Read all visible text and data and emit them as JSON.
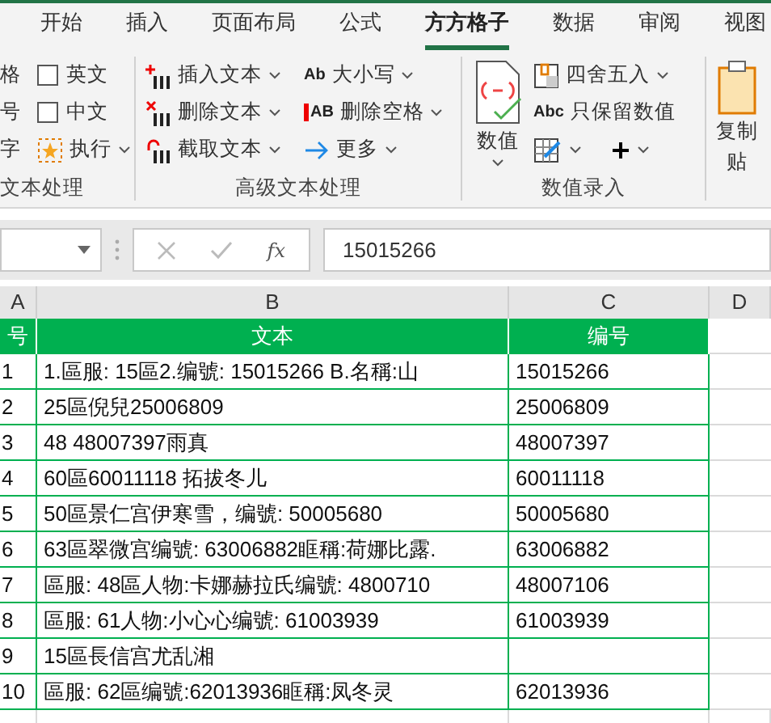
{
  "tabs": [
    {
      "label": "开始",
      "selected": false
    },
    {
      "label": "插入",
      "selected": false
    },
    {
      "label": "页面布局",
      "selected": false
    },
    {
      "label": "公式",
      "selected": false
    },
    {
      "label": "方方格子",
      "selected": true
    },
    {
      "label": "数据",
      "selected": false
    },
    {
      "label": "审阅",
      "selected": false
    },
    {
      "label": "视图",
      "selected": false
    }
  ],
  "ribbon": {
    "groups": [
      {
        "label": "文本处理",
        "columns": [
          [
            {
              "kind": "text",
              "label": "格"
            },
            {
              "kind": "text",
              "label": "号"
            },
            {
              "kind": "text",
              "label": "字"
            }
          ],
          [
            {
              "kind": "checkbox",
              "label": "英文",
              "checked": false
            },
            {
              "kind": "checkbox",
              "label": "中文",
              "checked": false
            },
            {
              "kind": "menu",
              "label": "执行",
              "dropdown": true
            }
          ]
        ]
      },
      {
        "label": "高级文本处理",
        "columns": [
          [
            {
              "kind": "menu",
              "label": "插入文本",
              "dropdown": true
            },
            {
              "kind": "menu",
              "label": "删除文本",
              "dropdown": true
            },
            {
              "kind": "menu",
              "label": "截取文本",
              "dropdown": true
            }
          ],
          [
            {
              "kind": "menu",
              "badge": "Ab",
              "label": "大小写",
              "dropdown": true
            },
            {
              "kind": "menu",
              "badge": "AB",
              "label": "删除空格",
              "dropdown": true
            },
            {
              "kind": "menu",
              "label": "更多",
              "dropdown": true
            }
          ]
        ]
      },
      {
        "label": "数值录入",
        "columns": [
          [
            {
              "kind": "big",
              "label": "数值",
              "dropdown": true
            }
          ],
          [
            {
              "kind": "menu",
              "label": "四舍五入",
              "dropdown": true
            },
            {
              "kind": "menu",
              "badge": "Abc",
              "label": "只保留数值"
            },
            {
              "kind": "icons",
              "dropdown": true
            }
          ]
        ]
      },
      {
        "columns": [
          [
            {
              "kind": "big",
              "lines": [
                "复制",
                "贴"
              ]
            }
          ]
        ]
      }
    ]
  },
  "formula_bar": {
    "function_label": "fx",
    "value": "15015266"
  },
  "sheet": {
    "columns": [
      "A",
      "B",
      "C",
      "D"
    ],
    "header": [
      "号",
      "文本",
      "编号"
    ],
    "rows": [
      {
        "number": "1",
        "text": "1.區服: 15區2.编號: 15015266 B.名稱:山",
        "code": "15015266"
      },
      {
        "number": "2",
        "text": "25區倪兒25006809",
        "code": "25006809"
      },
      {
        "number": "3",
        "text": "48 48007397雨真",
        "code": "48007397"
      },
      {
        "number": "4",
        "text": "60區60011118 拓拔冬儿",
        "code": "60011118"
      },
      {
        "number": "5",
        "text": "50區景仁宫伊寒雪，编號: 50005680",
        "code": "50005680"
      },
      {
        "number": "6",
        "text": "63區翠微宫编號: 63006882眶稱:荷娜比露.",
        "code": "63006882"
      },
      {
        "number": "7",
        "text": "區服: 48區人物:卡娜赫拉氏编號: 4800710",
        "code": "48007106"
      },
      {
        "number": "8",
        "text": "區服: 61人物:小心心编號: 61003939",
        "code": "61003939"
      },
      {
        "number": "9",
        "text": "15區長信宫尤乱湘"
      },
      {
        "number": "10",
        "text": "區服: 62區编號:62013936眶稱:凤冬灵",
        "code": "62013936"
      }
    ]
  }
}
